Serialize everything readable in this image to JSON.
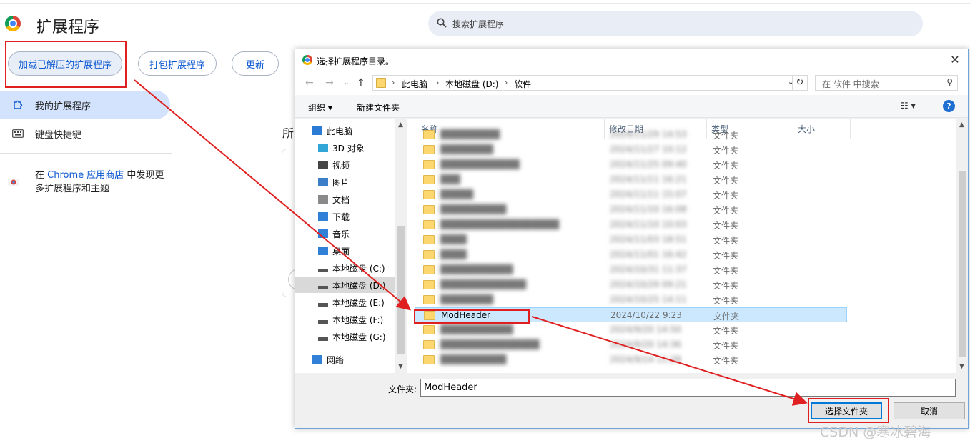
{
  "chrome_page": {
    "title": "扩展程序",
    "search_placeholder": "搜索扩展程序",
    "buttons": {
      "load_unpacked": "加载已解压的扩展程序",
      "pack": "打包扩展程序",
      "update": "更新"
    },
    "sidebar": {
      "my_extensions": "我的扩展程序",
      "shortcuts": "键盘快捷键",
      "store_prefix": "在 ",
      "store_link": "Chrome 应用商店",
      "store_suffix": " 中发现更多扩展程序和主题"
    },
    "all_label": "所"
  },
  "dialog": {
    "title": "选择扩展程序目录。",
    "breadcrumb": [
      "此电脑",
      "本地磁盘 (D:)",
      "软件"
    ],
    "search_placeholder": "在 软件 中搜索",
    "toolbar": {
      "organize": "组织 ▾",
      "new_folder": "新建文件夹"
    },
    "tree": [
      {
        "label": "此电脑",
        "icon": "pc-icon",
        "indent": 0
      },
      {
        "label": "3D 对象",
        "icon": "3d-objects-icon",
        "indent": 1
      },
      {
        "label": "视频",
        "icon": "video-icon",
        "indent": 1
      },
      {
        "label": "图片",
        "icon": "pictures-icon",
        "indent": 1
      },
      {
        "label": "文档",
        "icon": "documents-icon",
        "indent": 1
      },
      {
        "label": "下载",
        "icon": "download-icon",
        "indent": 1
      },
      {
        "label": "音乐",
        "icon": "music-icon",
        "indent": 1
      },
      {
        "label": "桌面",
        "icon": "desktop-icon",
        "indent": 1
      },
      {
        "label": "本地磁盘 (C:)",
        "icon": "drive-icon",
        "indent": 1
      },
      {
        "label": "本地磁盘 (D:)",
        "icon": "drive-icon",
        "indent": 1,
        "selected": true
      },
      {
        "label": "本地磁盘 (E:)",
        "icon": "drive-icon",
        "indent": 1
      },
      {
        "label": "本地磁盘 (F:)",
        "icon": "drive-icon",
        "indent": 1
      },
      {
        "label": "本地磁盘 (G:)",
        "icon": "drive-icon",
        "indent": 1
      },
      {
        "label": "网络",
        "icon": "network-icon",
        "indent": 0
      }
    ],
    "columns": [
      "名称",
      "修改日期",
      "类型",
      "大小"
    ],
    "rows": [
      {
        "name": "█████████",
        "date": "2024/11/29 14:53",
        "type": "文件夹",
        "blur": true
      },
      {
        "name": "████████",
        "date": "2024/11/27 10:12",
        "type": "文件夹",
        "blur": true
      },
      {
        "name": "████████████",
        "date": "2024/11/25 09:40",
        "type": "文件夹",
        "blur": true
      },
      {
        "name": "███",
        "date": "2024/11/11 16:21",
        "type": "文件夹",
        "blur": true
      },
      {
        "name": "█████",
        "date": "2024/11/11 15:07",
        "type": "文件夹",
        "blur": true
      },
      {
        "name": "██████████",
        "date": "2024/11/10 16:08",
        "type": "文件夹",
        "blur": true
      },
      {
        "name": "██████████████████",
        "date": "2024/11/10 10:03",
        "type": "文件夹",
        "blur": true
      },
      {
        "name": "████",
        "date": "2024/11/03 18:51",
        "type": "文件夹",
        "blur": true
      },
      {
        "name": "████",
        "date": "2024/11/01 16:42",
        "type": "文件夹",
        "blur": true
      },
      {
        "name": "███████████",
        "date": "2024/10/31 11:37",
        "type": "文件夹",
        "blur": true
      },
      {
        "name": "█████████████",
        "date": "2024/10/29 09:21",
        "type": "文件夹",
        "blur": true
      },
      {
        "name": "████████",
        "date": "2024/10/25 14:11",
        "type": "文件夹",
        "blur": true
      },
      {
        "name": "ModHeader",
        "date": "2024/10/22 9:23",
        "type": "文件夹",
        "selected": true
      },
      {
        "name": "███████████",
        "date": "2024/9/20 14:50",
        "type": "文件夹",
        "blur": true
      },
      {
        "name": "███████████████",
        "date": "2024/9/20 14:36",
        "type": "文件夹",
        "blur": true
      },
      {
        "name": "██████████",
        "date": "2024/9/14 11:28",
        "type": "文件夹",
        "blur": true
      }
    ],
    "filename_label": "文件夹:",
    "filename_value": "ModHeader",
    "select_button": "选择文件夹",
    "cancel_button": "取消"
  },
  "annotation_color": "#e02020",
  "watermark": "CSDN @寒冰碧海"
}
